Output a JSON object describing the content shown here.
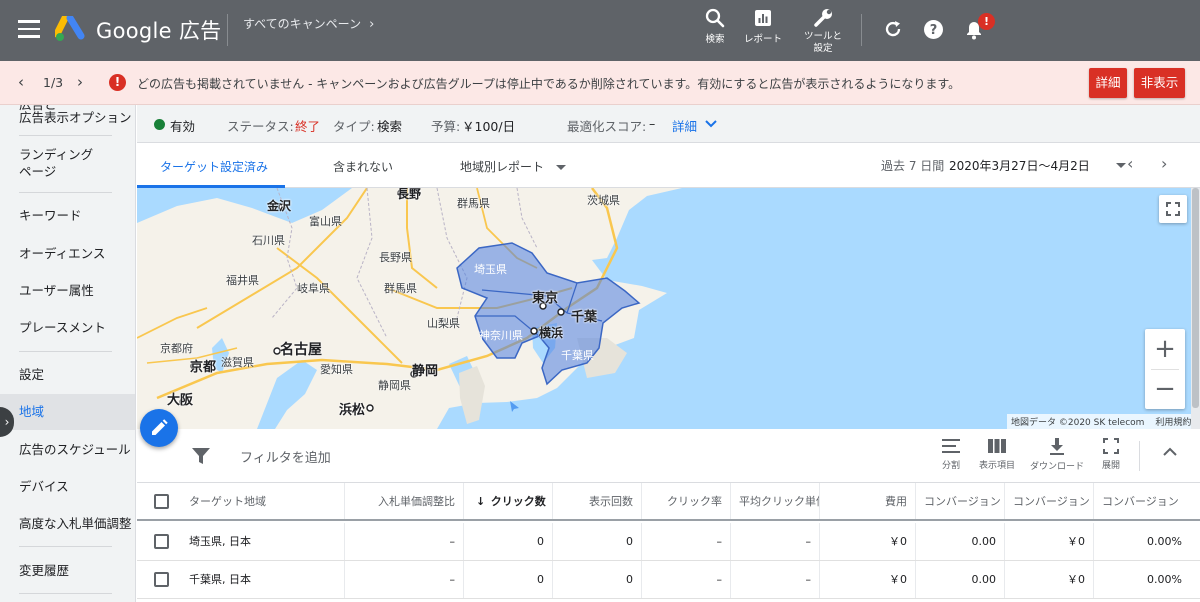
{
  "topbar": {
    "brand": "Google 広告",
    "breadcrumb": "すべてのキャンペーン",
    "tools": {
      "search": "検索",
      "report": "レポート",
      "tools_line1": "ツールと",
      "tools_line2": "設定"
    },
    "bell_badge": "!"
  },
  "notice": {
    "pager": "1/3",
    "message": "どの広告も掲載されていません - キャンペーンおよび広告グループは停止中であるか削除されています。有効にすると広告が表示されるようになります。",
    "detail_button": "詳細",
    "hide_button": "非表示"
  },
  "sidebar": {
    "items": [
      "広告と",
      "広告表示オプション",
      "ランディング",
      "ページ",
      "キーワード",
      "オーディエンス",
      "ユーザー属性",
      "プレースメント",
      "設定",
      "地域",
      "広告のスケジュール",
      "デバイス",
      "高度な入札単価調整",
      "変更履歴"
    ],
    "active": "地域"
  },
  "summary": {
    "status_enabled": "有効",
    "status_label": "ステータス:",
    "status_value": "終了",
    "type_label": "タイプ:",
    "type_value": "検索",
    "budget_label": "予算:",
    "budget_value": "￥100/日",
    "score_label": "最適化スコア:",
    "score_value": "–",
    "score_link": "詳細"
  },
  "tabs": {
    "targeted": "ターゲット設定済み",
    "excluded": "含まれない",
    "geo_report": "地域別レポート",
    "date_label": "過去 7 日間",
    "date_value": "2020年3月27日～4月2日"
  },
  "map": {
    "labels": {
      "nagano_city": "長野",
      "gunma": "群馬県",
      "ibaraki": "茨城県",
      "kanazawa": "金沢",
      "toyama": "富山県",
      "ishikawa": "石川県",
      "nagano": "長野県",
      "saitama": "埼玉県",
      "fukui": "福井県",
      "gifu": "岐阜県",
      "gunma_city": "群馬県",
      "tokyo": "東京",
      "chiba": "千葉",
      "yamanashi": "山梨県",
      "kanagawa": "神奈川県",
      "yokohama": "横浜",
      "chiba_pref": "千葉県",
      "kyoto_pref": "京都府",
      "nagoya": "名古屋",
      "kyoto": "京都",
      "shiga": "滋賀県",
      "aichi": "愛知県",
      "shizuoka": "静岡",
      "shizuoka_pref": "静岡県",
      "osaka": "大阪",
      "hamamatsu": "浜松"
    },
    "attribution": "地図データ ©2020 SK telecom",
    "terms": "利用規約"
  },
  "filterbar": {
    "add_filter": "フィルタを追加",
    "segment": "分割",
    "columns": "表示項目",
    "download": "ダウンロード",
    "expand": "展開"
  },
  "table": {
    "headers": [
      "ターゲット地域",
      "入札単価調整比",
      "クリック数",
      "表示回数",
      "クリック率",
      "平均クリック単価",
      "費用",
      "コンバージョン",
      "コンバージョン",
      "コンバージョン"
    ],
    "rows": [
      [
        "埼玉県, 日本",
        "–",
        "0",
        "0",
        "–",
        "–",
        "￥0",
        "0.00",
        "￥0",
        "0.00%"
      ],
      [
        "千葉県, 日本",
        "–",
        "0",
        "0",
        "–",
        "–",
        "￥0",
        "0.00",
        "￥0",
        "0.00%"
      ]
    ]
  },
  "colors": {
    "accent": "#1a73e8",
    "error": "#d93025",
    "topbar": "#5f6368",
    "enabled": "#188038"
  }
}
